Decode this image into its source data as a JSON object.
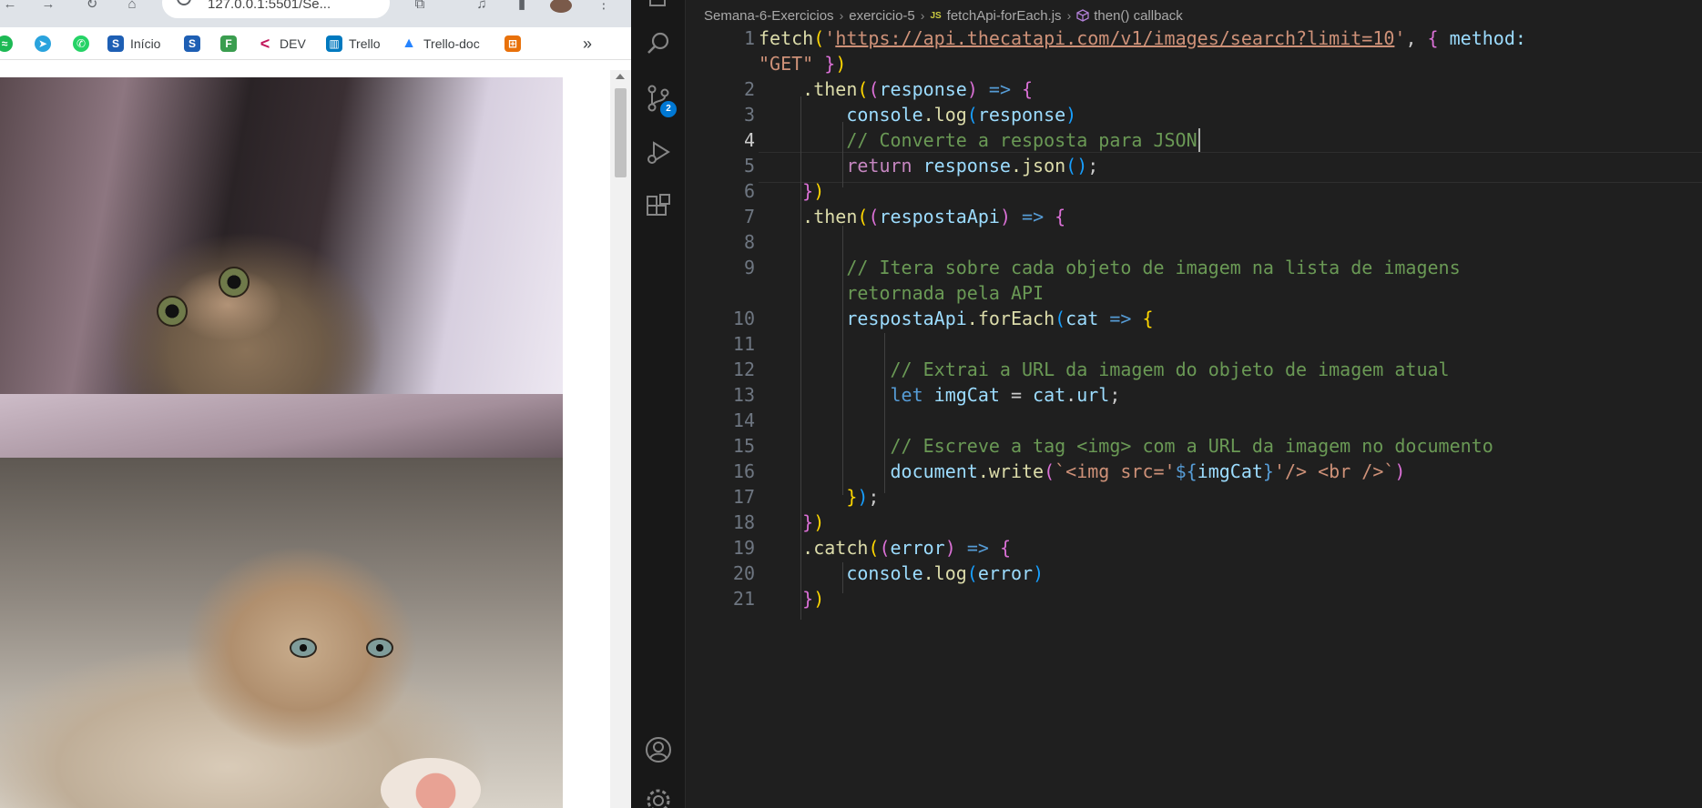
{
  "browser": {
    "address": "127.0.0.1:5501/Se...",
    "bookmarks": [
      {
        "label": "",
        "icon": "spotify-icon",
        "color": "#1db954"
      },
      {
        "label": "",
        "icon": "telegram-icon",
        "color": "#2aa3dd"
      },
      {
        "label": "",
        "icon": "whatsapp-icon",
        "color": "#25d366"
      },
      {
        "label": "Início",
        "icon": "s-icon",
        "color": "#1e5fb4"
      },
      {
        "label": "",
        "icon": "s-icon",
        "color": "#1e5fb4"
      },
      {
        "label": "",
        "icon": "f-icon",
        "color": "#3a9d4f"
      },
      {
        "label": "DEV",
        "icon": "chevron-left-icon",
        "color": "#c2185b"
      },
      {
        "label": "Trello",
        "icon": "trello-icon",
        "color": "#0079bf"
      },
      {
        "label": "Trello-doc",
        "icon": "atlassian-icon",
        "color": "#2684ff"
      },
      {
        "label": "",
        "icon": "grid-icon",
        "color": "#e8710a"
      }
    ],
    "overflow": "»"
  },
  "vscode": {
    "breadcrumb": [
      "Semana-6-Exercicios",
      "exercicio-5",
      "fetchApi-forEach.js",
      "then() callback"
    ],
    "file_icon": "JS",
    "scm_badge": "2",
    "active_line": "4",
    "line_numbers": [
      "1",
      "2",
      "3",
      "4",
      "5",
      "6",
      "7",
      "8",
      "9",
      "10",
      "11",
      "12",
      "13",
      "14",
      "15",
      "16",
      "17",
      "18",
      "19",
      "20",
      "21"
    ],
    "code": {
      "l1_fetch": "fetch",
      "l1_url": "https://api.thecatapi.com/v1/images/search?limit=10",
      "l1_method": "method:",
      "l1_get": "\"GET\"",
      "l2_then": ".then",
      "l2_param": "response",
      "l3_console": "console",
      "l3_log": ".log",
      "l3_arg": "response",
      "l4_comment": "// Converte a resposta para JSON",
      "l5_return": "return",
      "l5_obj": "response",
      "l5_json": ".json",
      "l7_then": ".then",
      "l7_param": "respostaApi",
      "l9_comment_a": "// Itera sobre cada objeto de imagem na lista de imagens",
      "l9_comment_b": "retornada pela API",
      "l10_obj": "respostaApi",
      "l10_foreach": ".forEach",
      "l10_param": "cat",
      "l12_comment": "// Extrai a URL da imagem do objeto de imagem atual",
      "l13_let": "let",
      "l13_var": "imgCat",
      "l13_obj": "cat",
      "l13_prop": "url",
      "l15_comment": "// Escreve a tag <img> com a URL da imagem no documento",
      "l16_doc": "document",
      "l16_write": ".write",
      "l16_tpl_a": "`<img src='",
      "l16_interp_var": "imgCat",
      "l16_tpl_b": "'/> <br />`",
      "l19_catch": ".catch",
      "l19_param": "error",
      "l20_console": "console",
      "l20_log": ".log",
      "l20_arg": "error"
    }
  }
}
